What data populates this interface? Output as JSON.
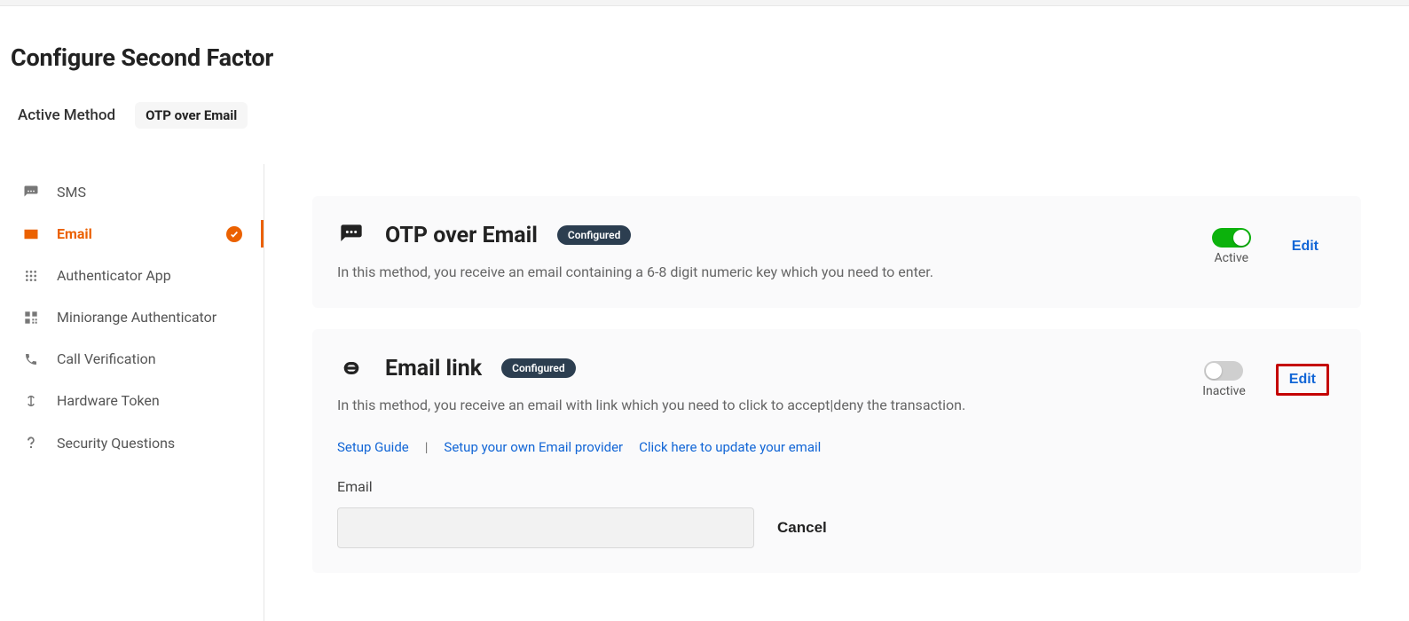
{
  "page_title": "Configure Second Factor",
  "active_method_label": "Active Method",
  "active_method_value": "OTP over Email",
  "sidebar": {
    "items": [
      {
        "label": "SMS"
      },
      {
        "label": "Email"
      },
      {
        "label": "Authenticator App"
      },
      {
        "label": "Miniorange Authenticator"
      },
      {
        "label": "Call Verification"
      },
      {
        "label": "Hardware Token"
      },
      {
        "label": "Security Questions"
      }
    ]
  },
  "cards": {
    "otp_email": {
      "title": "OTP over Email",
      "badge": "Configured",
      "description": "In this method, you receive an email containing a 6-8 digit numeric key which you need to enter.",
      "toggle_state": "Active",
      "edit": "Edit"
    },
    "email_link": {
      "title": "Email link",
      "badge": "Configured",
      "description": "In this method, you receive an email with link which you need to click to accept|deny the transaction.",
      "toggle_state": "Inactive",
      "edit": "Edit",
      "links": {
        "setup_guide": "Setup Guide",
        "sep": "|",
        "own_provider": "Setup your own Email provider",
        "update_email": "Click here to update your email"
      },
      "email_label": "Email",
      "email_value": "",
      "cancel": "Cancel"
    }
  }
}
